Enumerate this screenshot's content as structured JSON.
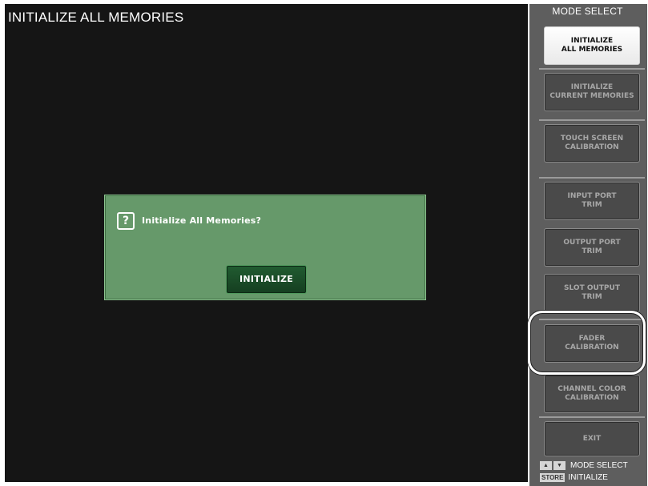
{
  "main": {
    "title": "INITIALIZE ALL MEMORIES"
  },
  "dialog": {
    "icon_text": "?",
    "icon": "question-icon",
    "message": "Initialize All Memories?",
    "button_label": "INITIALIZE"
  },
  "sidebar": {
    "title": "MODE SELECT",
    "buttons": [
      {
        "label": "INITIALIZE\nALL MEMORIES",
        "active": true
      },
      {
        "label": "INITIALIZE\nCURRENT MEMORIES",
        "active": false
      },
      {
        "label": "TOUCH SCREEN\nCALIBRATION",
        "active": false
      },
      {
        "label": "INPUT PORT\nTRIM",
        "active": false
      },
      {
        "label": "OUTPUT PORT\nTRIM",
        "active": false
      },
      {
        "label": "SLOT OUTPUT\nTRIM",
        "active": false
      },
      {
        "label": "FADER\nCALIBRATION",
        "active": false,
        "highlighted": true
      },
      {
        "label": "CHANNEL COLOR\nCALIBRATION",
        "active": false
      },
      {
        "label": "EXIT",
        "active": false
      }
    ],
    "footer": {
      "arrows_label": "MODE SELECT",
      "store_key": "STORE",
      "store_label": "INITIALIZE"
    }
  },
  "colors": {
    "dialog_bg": "#66996a",
    "button_green": "#1e5430",
    "sidebar_bg": "#5e5e5e",
    "active_button": "#ffffff"
  }
}
